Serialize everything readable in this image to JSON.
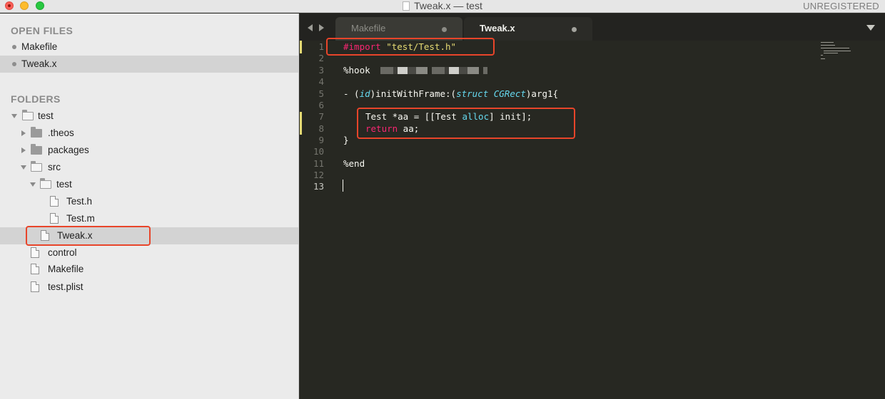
{
  "window": {
    "title": "Tweak.x — test",
    "registration": "UNREGISTERED"
  },
  "sidebar": {
    "open_files_header": "OPEN FILES",
    "open_files": [
      {
        "label": "Makefile"
      },
      {
        "label": "Tweak.x"
      }
    ],
    "folders_header": "FOLDERS",
    "tree": [
      {
        "label": "test"
      },
      {
        "label": ".theos"
      },
      {
        "label": "packages"
      },
      {
        "label": "src"
      },
      {
        "label": "test"
      },
      {
        "label": "Test.h"
      },
      {
        "label": "Test.m"
      },
      {
        "label": "Tweak.x"
      },
      {
        "label": "control"
      },
      {
        "label": "Makefile"
      },
      {
        "label": "test.plist"
      }
    ]
  },
  "tabs": [
    {
      "label": "Makefile"
    },
    {
      "label": "Tweak.x"
    }
  ],
  "editor": {
    "line_numbers": [
      "1",
      "2",
      "3",
      "4",
      "5",
      "6",
      "7",
      "8",
      "9",
      "10",
      "11",
      "12",
      "13"
    ],
    "code": {
      "l1_directive": "#import",
      "l1_string": "\"test/Test.h\"",
      "l3_hook": "%hook",
      "l5_prefix": "- (",
      "l5_id": "id",
      "l5_mid": ")initWithFrame:(",
      "l5_struct": "struct",
      "l5_cgrect": "CGRect",
      "l5_suffix": ")arg1{",
      "l7_prefix": "Test *aa = [[Test ",
      "l7_alloc": "alloc",
      "l7_suffix": "] init];",
      "l8_return": "return",
      "l8_suffix": " aa;",
      "l9_brace": "}",
      "l11_end": "%end"
    }
  },
  "colors": {
    "annotation_box": "#e8452a",
    "keyword": "#f92672",
    "string": "#e6db74",
    "type": "#66d9ef"
  }
}
